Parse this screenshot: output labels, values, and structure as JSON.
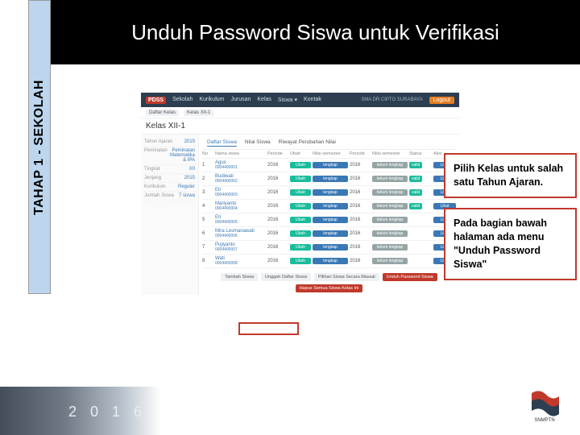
{
  "slide": {
    "title": "Unduh Password Siswa\nuntuk Verifikasi",
    "side_label": "TAHAP 1 - SEKOLAH",
    "year": "2 0 1 6",
    "logo_caption": "SNMPTN"
  },
  "callouts": {
    "c1": "Pilih Kelas untuk salah satu Tahun Ajaran.",
    "c2": "Pada bagian bawah halaman ada menu \"Unduh Password Siswa\""
  },
  "app": {
    "brand": "PDSS",
    "nav": [
      "Sekolah",
      "Kurikulum",
      "Jurusan",
      "Kelas",
      "Siswa ▾",
      "Kontak"
    ],
    "user": "SMA DR CIPTO SURABAYA",
    "logout": "Logout",
    "crumb_chain": [
      "Daftar Kelas",
      "Kelas XII-1"
    ],
    "page_head": "Kelas XII-1",
    "tabs": [
      "Daftar Siswa",
      "Nilai Siswa",
      "Riwayat Perubahan Nilai"
    ]
  },
  "sidebar": [
    {
      "l": "Tahun Ajaran",
      "v": "2015"
    },
    {
      "l": "Peminatan",
      "v": "Peminatan Matematika & IPA"
    },
    {
      "l": "Tingkat",
      "v": "XII"
    },
    {
      "l": "Jenjang",
      "v": "2015"
    },
    {
      "l": "Kurikulum",
      "v": "Reguler"
    },
    {
      "l": "Jumlah Siswa",
      "v": "7 siswa"
    }
  ],
  "table": {
    "headers": [
      "No",
      "Nama siswa",
      "Periode",
      "Ubah",
      "Nilai semester",
      "Periode",
      "Nilai semester",
      "Status",
      "Aksi"
    ],
    "rows": [
      {
        "n": "1",
        "name": "Agus",
        "nisn": "0004400001",
        "p1": "2016",
        "u": "Ubah",
        "ns1": "lengkap",
        "p2": "2016",
        "ns2": "belum lengkap",
        "st": "valid",
        "ak": "Lihat"
      },
      {
        "n": "2",
        "name": "Budiwati",
        "nisn": "0004400002",
        "p1": "2016",
        "u": "Ubah",
        "ns1": "lengkap",
        "p2": "2016",
        "ns2": "belum lengkap",
        "st": "valid",
        "ak": "Lihat"
      },
      {
        "n": "3",
        "name": "Eti",
        "nisn": "0004400003",
        "p1": "2016",
        "u": "Ubah",
        "ns1": "lengkap",
        "p2": "2016",
        "ns2": "belum lengkap",
        "st": "valid",
        "ak": "Lihat"
      },
      {
        "n": "4",
        "name": "Mariyanto",
        "nisn": "0004400004",
        "p1": "2016",
        "u": "Ubah",
        "ns1": "lengkap",
        "p2": "2016",
        "ns2": "belum lengkap",
        "st": "valid",
        "ak": "Lihat"
      },
      {
        "n": "5",
        "name": "Eti",
        "nisn": "0004400005",
        "p1": "2016",
        "u": "Ubah",
        "ns1": "lengkap",
        "p2": "2016",
        "ns2": "belum lengkap",
        "st": "",
        "ak": "Lihat"
      },
      {
        "n": "6",
        "name": "Mira Lesmanawati",
        "nisn": "0004400006",
        "p1": "2016",
        "u": "Ubah",
        "ns1": "lengkap",
        "p2": "2016",
        "ns2": "belum lengkap",
        "st": "",
        "ak": "Lihat"
      },
      {
        "n": "7",
        "name": "Pujiyanto",
        "nisn": "0004400007",
        "p1": "2016",
        "u": "Ubah",
        "ns1": "lengkap",
        "p2": "2016",
        "ns2": "belum lengkap",
        "st": "",
        "ak": "Lihat"
      },
      {
        "n": "8",
        "name": "Wati",
        "nisn": "0004400008",
        "p1": "2016",
        "u": "Ubah",
        "ns1": "lengkap",
        "p2": "2016",
        "ns2": "belum lengkap",
        "st": "",
        "ak": "Lihat"
      }
    ]
  },
  "footer_buttons": [
    "Tambah Siswa",
    "Unggah Daftar Siswa",
    "Pilihan Siswa Secara Massal",
    "Unduh Password Siswa",
    "Hapus Semua Siswa Kelas Ini"
  ]
}
